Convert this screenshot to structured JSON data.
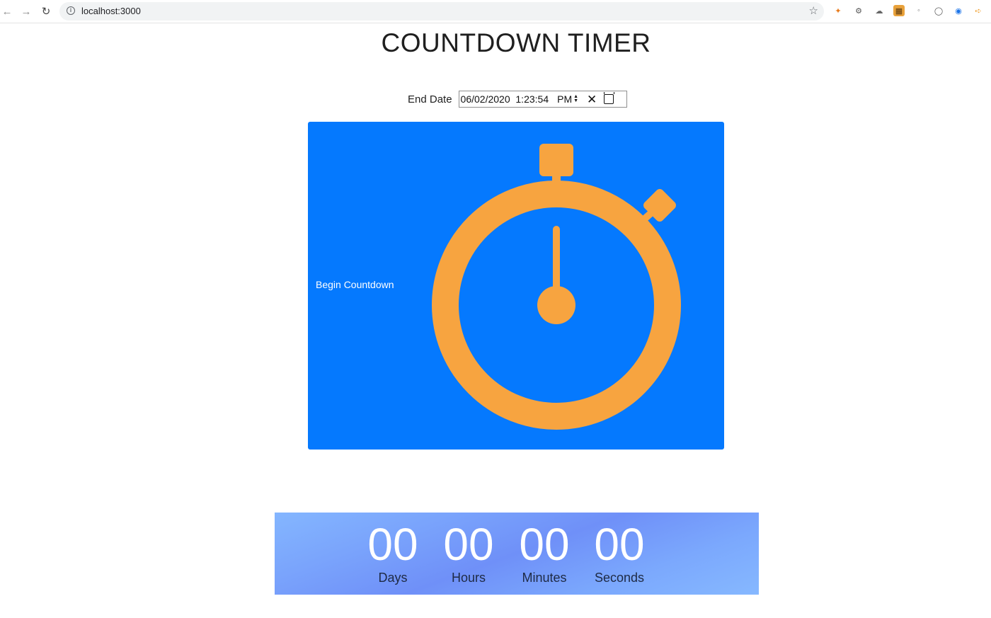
{
  "browser": {
    "url": "localhost:3000",
    "nav": {
      "back_icon": "arrow-left-icon",
      "forward_icon": "arrow-right-icon",
      "reload_icon": "reload-icon"
    },
    "extensions": [
      "fox-extension-icon",
      "puzzle-extension-icon",
      "cloud-extension-icon",
      "giraffe-extension-icon",
      "dot-extension-icon",
      "circle-extension-icon",
      "ring-extension-icon",
      "arrow-extension-icon"
    ]
  },
  "page": {
    "title": "COUNTDOWN TIMER",
    "end_date": {
      "label": "End Date",
      "value": "06/02/2020  1:23:54",
      "ampm": "PM"
    },
    "begin_button": "Begin Countdown",
    "colors": {
      "panel": "#0579fe",
      "stopwatch": "#f7a440"
    },
    "timer": {
      "units": [
        {
          "value": "00",
          "label": "Days"
        },
        {
          "value": "00",
          "label": "Hours"
        },
        {
          "value": "00",
          "label": "Minutes"
        },
        {
          "value": "00",
          "label": "Seconds"
        }
      ]
    }
  }
}
